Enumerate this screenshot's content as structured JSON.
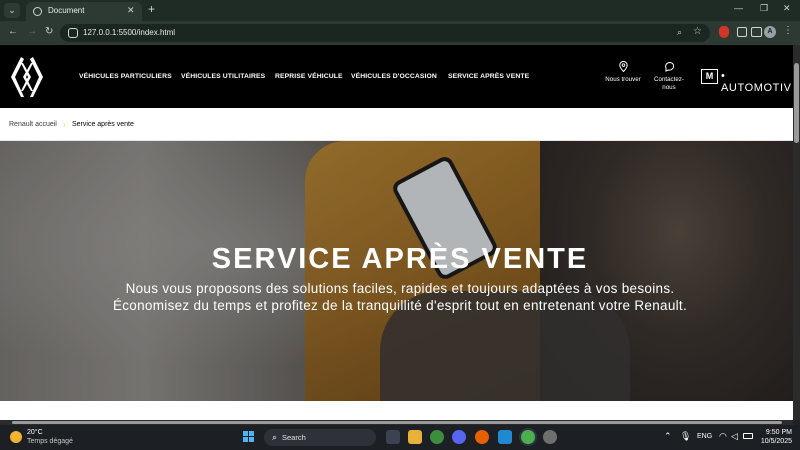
{
  "browser": {
    "tab": {
      "title": "Document"
    },
    "url": "127.0.0.1:5500/index.html",
    "profile_initial": "A"
  },
  "site": {
    "nav": [
      {
        "label": "VÉHICULES PARTICULIERS"
      },
      {
        "label": "VÉHICULES UTILITAIRES"
      },
      {
        "label": "REPRISE VÉHICULE"
      },
      {
        "label": "VÉHICULES D'OCCASION"
      },
      {
        "label": "SERVICE APRÈS VENTE"
      }
    ],
    "actions": {
      "find_us": "Nous trouver",
      "contact_line1": "Contactez-",
      "contact_line2": "nous"
    },
    "brand_badge": "M",
    "brand_text": "• AUTOMOTIV"
  },
  "breadcrumb": {
    "home": "Renault accueil",
    "separator": "›",
    "current": "Service après vente"
  },
  "hero": {
    "title": "SERVICE APRÈS VENTE",
    "subtitle_line1": "Nous vous proposons des solutions faciles, rapides et toujours adaptées à vos besoins.",
    "subtitle_line2": "Économisez du temps et profitez de la tranquillité d'esprit tout en entretenant votre Renault."
  },
  "taskbar": {
    "weather_temp": "20°C",
    "weather_desc": "Temps dégagé",
    "search_label": "Search",
    "language": "ENG",
    "time": "9:50 PM",
    "date": "10/5/2025"
  },
  "colors": {
    "accent_yellow": "#efdf00",
    "header_bg": "#000000",
    "browser_frame": "#1f2b25"
  }
}
